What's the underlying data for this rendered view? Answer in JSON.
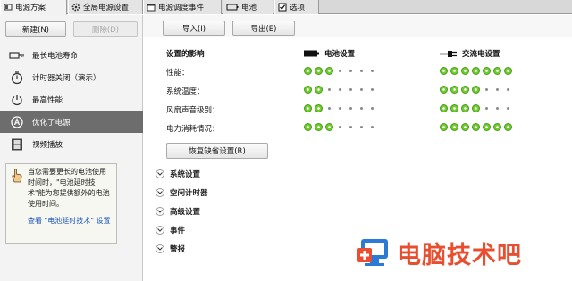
{
  "tabs": [
    {
      "label": "电源方案",
      "icon": "power-plan-icon"
    },
    {
      "label": "全局电源设置",
      "icon": "gear-icon"
    },
    {
      "label": "电源调度事件",
      "icon": "calendar-icon"
    },
    {
      "label": "电池",
      "icon": "battery-icon"
    },
    {
      "label": "选项",
      "icon": "checkbox-icon"
    }
  ],
  "left_buttons": {
    "new": "新建(N)",
    "delete": "删除(D)"
  },
  "toolbar": {
    "import": "导入(I)",
    "export": "导出(E)"
  },
  "schemes": [
    {
      "label": "最长电池寿命",
      "icon": "battery-plug-icon"
    },
    {
      "label": "计时器关闭（演示）",
      "icon": "stopwatch-icon"
    },
    {
      "label": "最高性能",
      "icon": "power-icon"
    },
    {
      "label": "优化了电源",
      "icon": "a-circle-icon",
      "selected": true
    },
    {
      "label": "视频播放",
      "icon": "film-icon"
    }
  ],
  "tip": {
    "text": "当您需要更长的电池使用时间时，\"电池延时技术\"能为您提供额外的电池使用时间。",
    "link": "查看 \"电池延时技术\" 设置"
  },
  "settings": {
    "header": "设置的影响",
    "battery_header": "电池设置",
    "ac_header": "交流电设置",
    "rows": [
      {
        "label": "性能：",
        "battery": 3,
        "ac": 7
      },
      {
        "label": "系统温度：",
        "battery": 2,
        "ac": 4
      },
      {
        "label": "风扇声音级别：",
        "battery": 2,
        "ac": 4
      },
      {
        "label": "电力消耗情况：",
        "battery": 3,
        "ac": 7
      }
    ],
    "total_dots": 7,
    "restore": "恢复缺省设置(R)"
  },
  "sections": [
    "系统设置",
    "空闲计时器",
    "高级设置",
    "事件",
    "警报"
  ],
  "watermark": "电脑技术吧",
  "colors": {
    "accent_green": "#6fcf2c",
    "selected_bg": "#6d6d6d",
    "watermark": "#e84e2f",
    "link": "#1c56b8"
  }
}
